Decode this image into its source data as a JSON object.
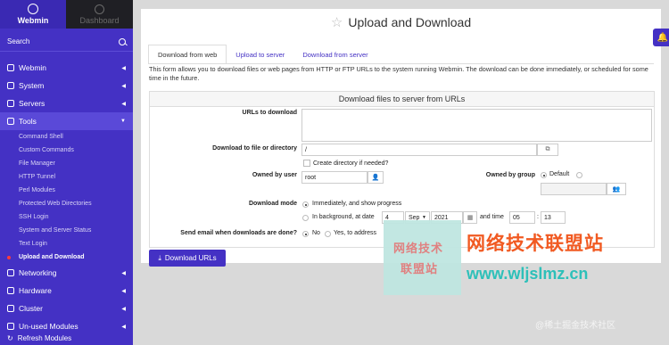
{
  "sidebar": {
    "brand": "Webmin",
    "dashboard": "Dashboard",
    "search": "Search",
    "categories": [
      {
        "label": "Webmin",
        "icon": "gear-icon"
      },
      {
        "label": "System",
        "icon": "monitor-icon"
      },
      {
        "label": "Servers",
        "icon": "server-icon"
      },
      {
        "label": "Tools",
        "icon": "wrench-icon"
      }
    ],
    "tools_items": [
      "Command Shell",
      "Custom Commands",
      "File Manager",
      "HTTP Tunnel",
      "Perl Modules",
      "Protected Web Directories",
      "SSH Login",
      "System and Server Status",
      "Text Login",
      "Upload and Download"
    ],
    "categories_after": [
      {
        "label": "Networking",
        "icon": "globe-icon"
      },
      {
        "label": "Hardware",
        "icon": "hardware-icon"
      },
      {
        "label": "Cluster",
        "icon": "cluster-icon"
      },
      {
        "label": "Un-used Modules",
        "icon": "puzzle-icon"
      }
    ],
    "refresh": "Refresh Modules"
  },
  "page": {
    "title": "Upload and Download",
    "tabs": [
      "Download from web",
      "Upload to server",
      "Download from server"
    ],
    "description": "This form allows you to download files or web pages from HTTP or FTP URLs to the system running Webmin. The download can be done immediately, or scheduled for some time in the future."
  },
  "form": {
    "header": "Download files to server from URLs",
    "urls_label": "URLs to download",
    "dest_label": "Download to file or directory",
    "dest_value": "/",
    "create_dir": "Create directory if needed?",
    "owner_label": "Owned by user",
    "owner_value": "root",
    "group_label": "Owned by group",
    "group_default": "Default",
    "mode_label": "Download mode",
    "mode_immediate": "Immediately, and show progress",
    "mode_background": "In background, at date",
    "date_day": "4",
    "date_month": "Sep",
    "date_year": "2021",
    "time_label": "and time",
    "time_hour": "05",
    "time_minute": "13",
    "email_label": "Send email when downloads are done?",
    "email_no": "No",
    "email_yes": "Yes, to address",
    "submit": "Download URLs"
  },
  "watermark": {
    "small_line1": "网络技术",
    "small_line2": "联盟站",
    "big": "网络技术联盟站",
    "url": "www.wljslmz.cn",
    "source": "@稀土掘金技术社区"
  }
}
